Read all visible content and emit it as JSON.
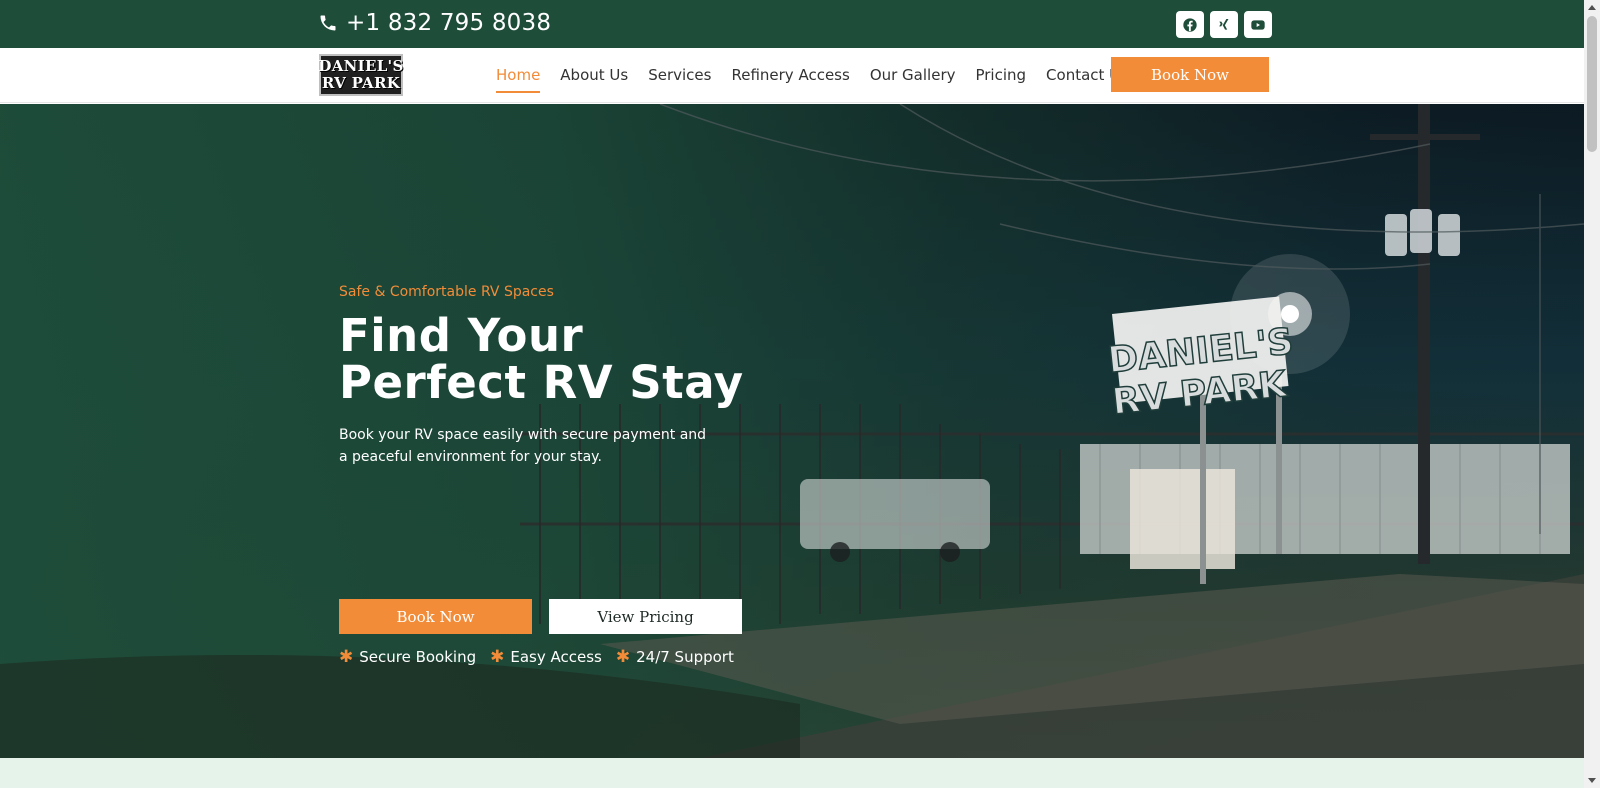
{
  "topbar": {
    "phone": "+1 832 795 8038",
    "socials": [
      {
        "icon": "facebook-icon"
      },
      {
        "icon": "xing-icon"
      },
      {
        "icon": "youtube-icon"
      }
    ]
  },
  "logo": {
    "line1": "DANIEL'S",
    "line2": "RV PARK"
  },
  "nav": {
    "items": [
      {
        "label": "Home",
        "active": true
      },
      {
        "label": "About Us"
      },
      {
        "label": "Services"
      },
      {
        "label": "Refinery Access"
      },
      {
        "label": "Our Gallery"
      },
      {
        "label": "Pricing"
      },
      {
        "label": "Contact Us"
      }
    ],
    "cta": "Book Now"
  },
  "hero": {
    "tagline": "Safe & Comfortable RV Spaces",
    "headline": "Find Your Perfect RV Stay",
    "subtext": "Book your RV space easily with secure payment and a peaceful environment for your stay.",
    "primary_button": "Book Now",
    "secondary_button": "View Pricing",
    "features": [
      "Secure Booking",
      "Easy Access",
      "24/7 Support"
    ],
    "sign_text": {
      "line1": "DANIEL'S",
      "line2": "RV PARK"
    }
  },
  "colors": {
    "brand_green": "#1e4d3a",
    "accent_orange": "#f28c38",
    "light_section": "#e6f3ea"
  }
}
